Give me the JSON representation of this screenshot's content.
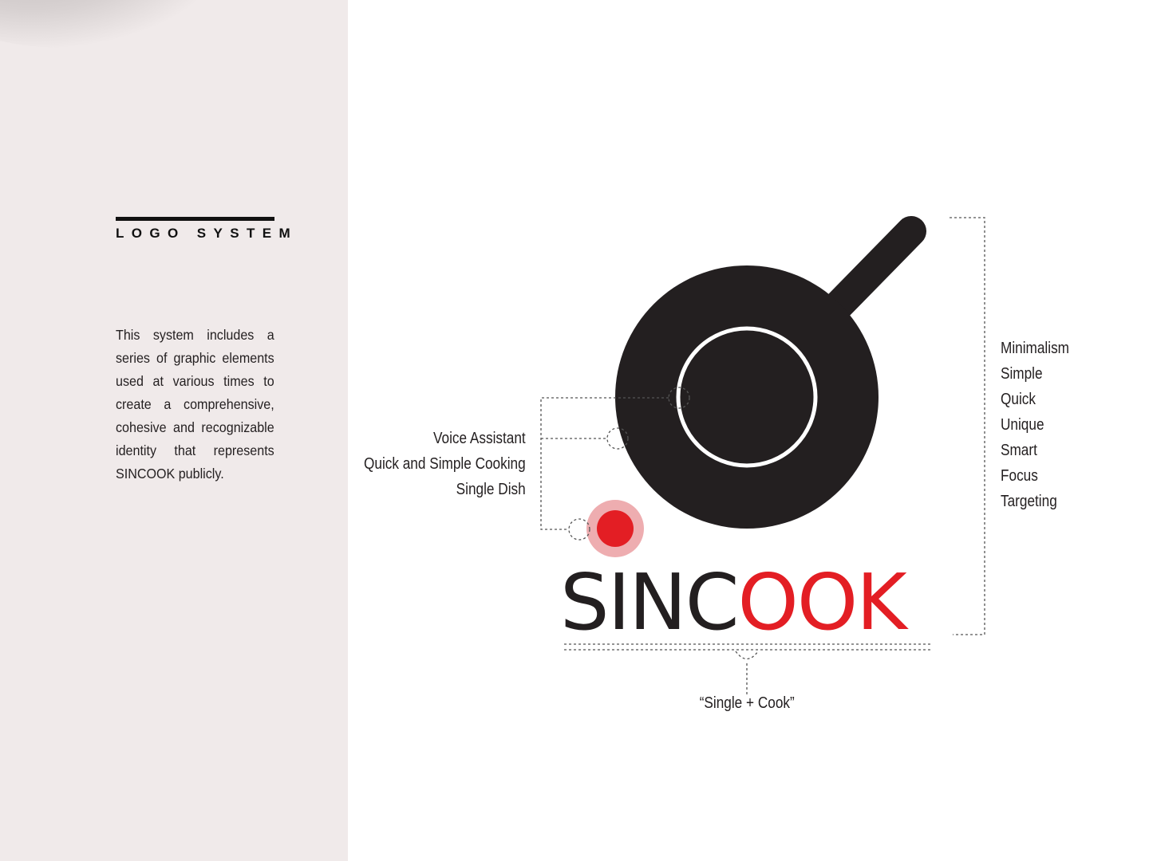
{
  "sidebar": {
    "section_title": "LOGO SYSTEM",
    "description": "This system includes a series of graphic elements used at various times to create a comprehensive, cohesive and recognizable identity that represents SINCOOK publicly."
  },
  "logo": {
    "wordmark_dark": "SINC",
    "wordmark_red": "OOK",
    "colors": {
      "dark": "#231f20",
      "accent": "#e31e24",
      "accent_halo": "#eeadb0"
    }
  },
  "annotations": {
    "left": [
      "Voice Assistant",
      "Quick and Simple Cooking",
      "Single Dish"
    ],
    "right": [
      "Minimalism",
      "Simple",
      "Quick",
      "Unique",
      "Smart",
      "Focus",
      "Targeting"
    ],
    "caption": "“Single + Cook”"
  }
}
